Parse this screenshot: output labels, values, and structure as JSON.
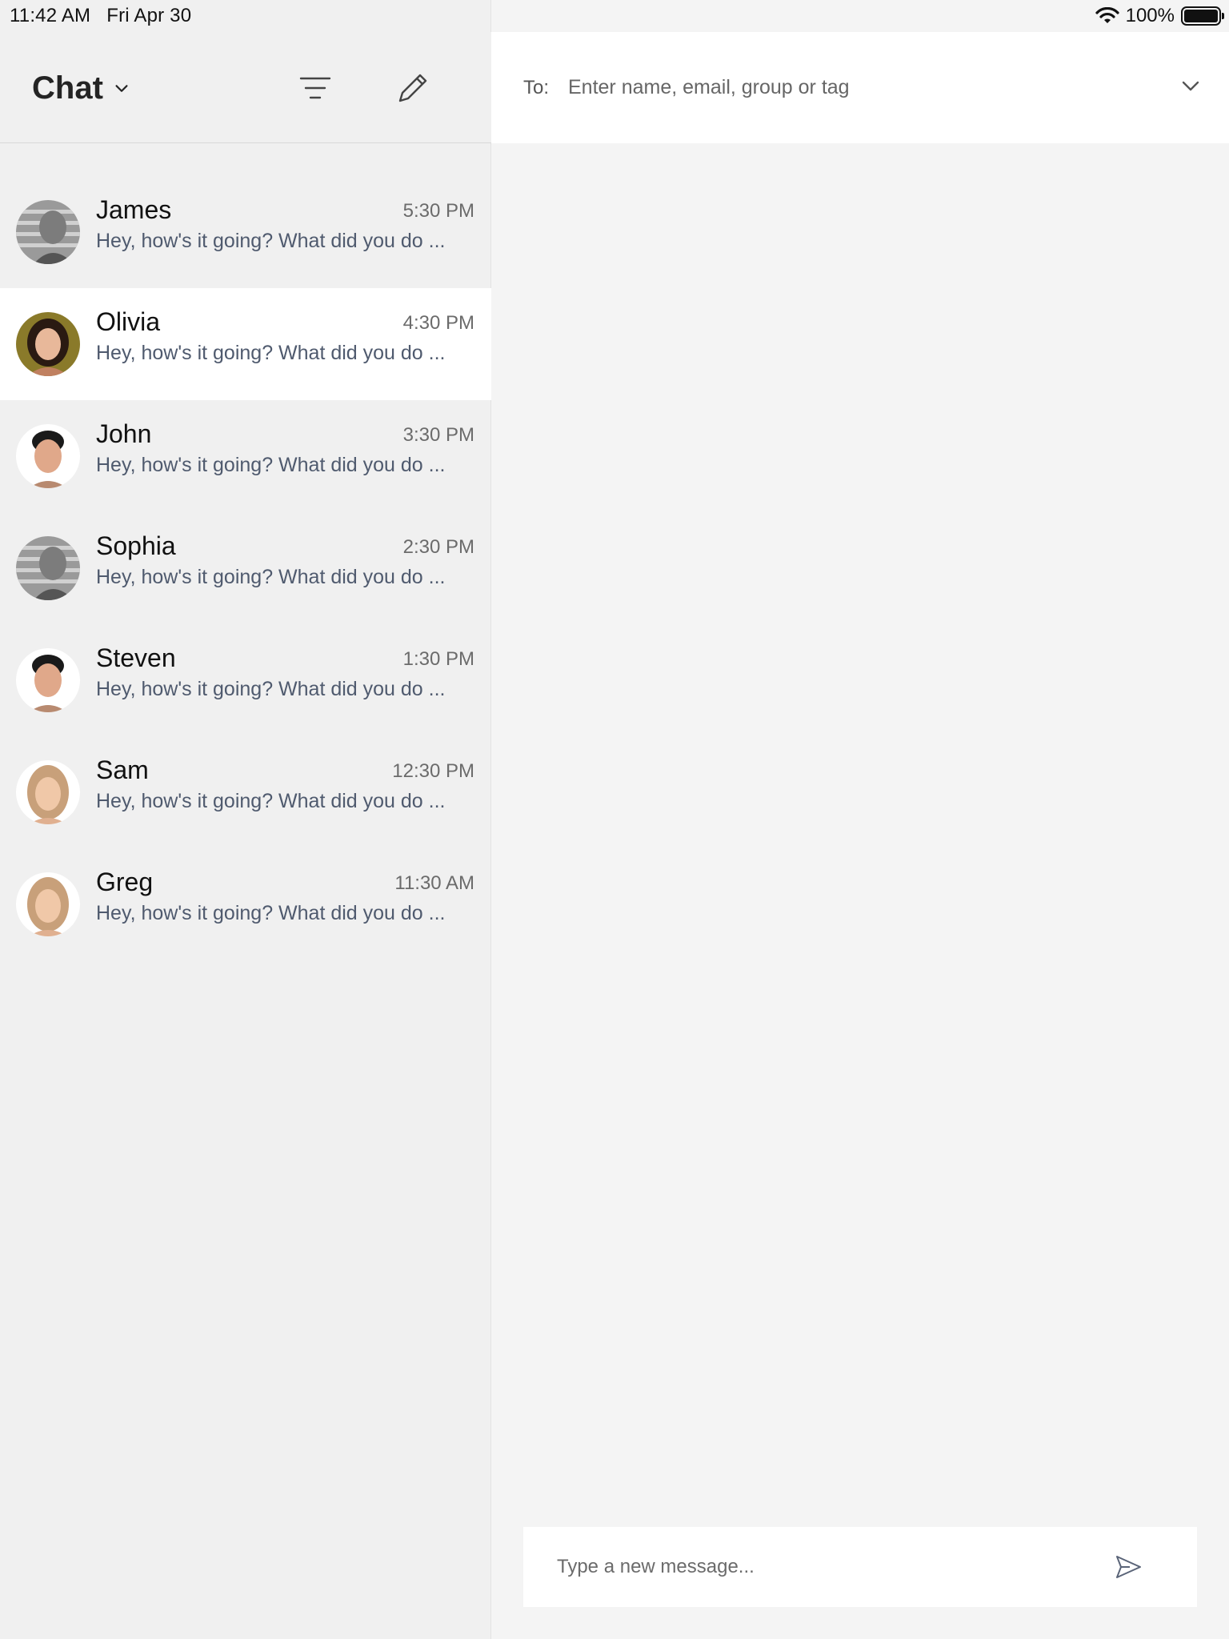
{
  "status_bar": {
    "time": "11:42 AM",
    "date": "Fri Apr 30",
    "battery": "100%",
    "icons": [
      "wifi-icon",
      "battery-icon"
    ]
  },
  "left_header": {
    "title": "Chat",
    "icons": [
      "chevron-down-icon",
      "filter-icon",
      "compose-icon"
    ]
  },
  "chats": [
    {
      "name": "James",
      "time": "5:30 PM",
      "preview": "Hey, how's it going? What did you do ...",
      "selected": false
    },
    {
      "name": "Olivia",
      "time": "4:30 PM",
      "preview": "Hey, how's it going? What did you do ...",
      "selected": true
    },
    {
      "name": "John",
      "time": "3:30 PM",
      "preview": "Hey, how's it going? What did you do ...",
      "selected": false
    },
    {
      "name": "Sophia",
      "time": "2:30 PM",
      "preview": "Hey, how's it going? What did you do ...",
      "selected": false
    },
    {
      "name": "Steven",
      "time": "1:30 PM",
      "preview": "Hey, how's it going? What did you do ...",
      "selected": false
    },
    {
      "name": "Sam",
      "time": "12:30 PM",
      "preview": "Hey, how's it going? What did you do ...",
      "selected": false
    },
    {
      "name": "Greg",
      "time": "11:30 AM",
      "preview": "Hey, how's it going? What did you do ...",
      "selected": false
    }
  ],
  "to_bar": {
    "label": "To:",
    "placeholder": "Enter name, email, group or tag"
  },
  "compose": {
    "placeholder": "Type a new message...",
    "icon": "send-icon"
  },
  "colors": {
    "selected_row": "#ffffff",
    "pane_bg": "#f0f0f0",
    "preview_text": "#4f5a6e"
  }
}
